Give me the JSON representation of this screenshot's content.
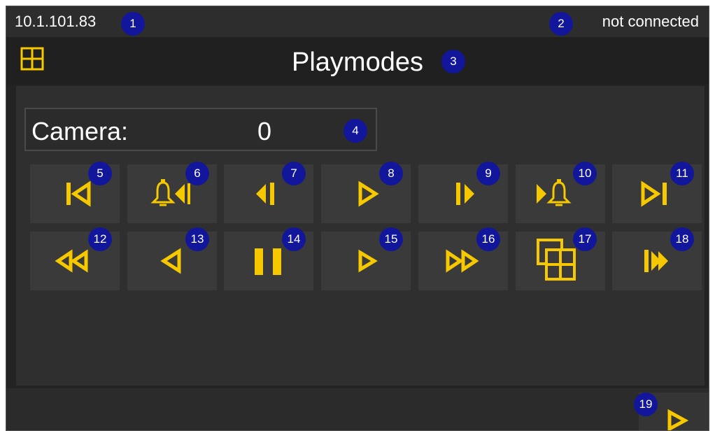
{
  "status": {
    "ip": "10.1.101.83",
    "connection": "not connected"
  },
  "header": {
    "title": "Playmodes",
    "menu_icon": "grid-menu-icon"
  },
  "camera": {
    "label": "Camera:",
    "value": "0"
  },
  "buttons": [
    {
      "id": "jump-to-start",
      "icon": "skip-to-start-icon"
    },
    {
      "id": "previous-alarm",
      "icon": "alarm-previous-icon"
    },
    {
      "id": "step-back",
      "icon": "step-back-icon"
    },
    {
      "id": "play",
      "icon": "play-icon"
    },
    {
      "id": "step-forward",
      "icon": "step-forward-icon"
    },
    {
      "id": "next-alarm",
      "icon": "alarm-next-icon"
    },
    {
      "id": "jump-to-end",
      "icon": "skip-to-end-icon"
    },
    {
      "id": "fast-rewind",
      "icon": "fast-rewind-icon"
    },
    {
      "id": "play-reverse",
      "icon": "play-reverse-icon"
    },
    {
      "id": "pause",
      "icon": "pause-icon"
    },
    {
      "id": "play-2",
      "icon": "play-icon"
    },
    {
      "id": "fast-forward",
      "icon": "fast-forward-icon"
    },
    {
      "id": "multiview",
      "icon": "multiview-icon"
    },
    {
      "id": "live",
      "icon": "live-icon"
    }
  ],
  "footer": {
    "next_icon": "next-page-icon"
  },
  "badges": [
    "1",
    "2",
    "3",
    "4",
    "5",
    "6",
    "7",
    "8",
    "9",
    "10",
    "11",
    "12",
    "13",
    "14",
    "15",
    "16",
    "17",
    "18",
    "19"
  ],
  "colors": {
    "accent": "#f5c800",
    "badge": "#12169a",
    "background": "#232323",
    "button": "#3a3a3a"
  }
}
